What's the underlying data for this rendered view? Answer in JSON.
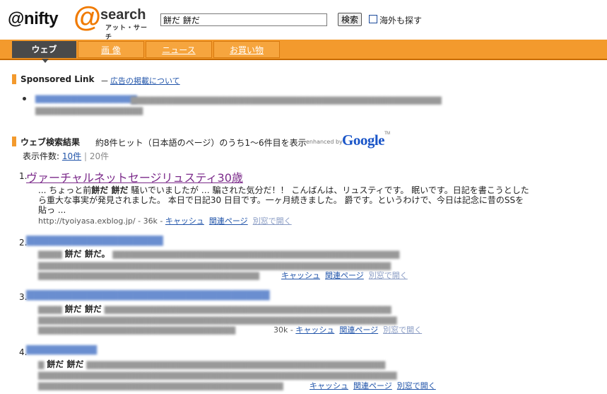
{
  "header": {
    "logo_nifty": "@nifty",
    "logo_at": "@",
    "logo_search": "search",
    "logo_sub": "アット・サーチ",
    "search_value": "餅だ 餅だ",
    "search_button": "検索",
    "overseas_label": "海外も探す"
  },
  "tabs": [
    {
      "label": "ウェブ",
      "active": true
    },
    {
      "label": "画 像"
    },
    {
      "label": "ニュース"
    },
    {
      "label": "お買い物"
    }
  ],
  "sponsored": {
    "title": "Sponsored Link",
    "dash": "－",
    "link": "広告の掲載について"
  },
  "results_header": {
    "title": "ウェブ検索結果",
    "summary": "約8件ヒット（日本語のページ）のうち1〜6件目を表示",
    "enhanced": "enhanced by",
    "google": "Google",
    "tm": "TM",
    "display_label": "表示件数:",
    "opt_10": "10件",
    "sep": "|",
    "opt_20": "20件"
  },
  "results": [
    {
      "num": "1.",
      "title": "ヴァーチャルネットセージリュスティ30歳",
      "snippet_pre": "... ちょっと前",
      "snippet_bold": "餅だ 餅だ",
      "snippet_post": " 騒いでいましたが … 騙された気分だ！！ こんばんは、リュスティです。 眠いです。日記を書こうとしたら重大な事実が発見されました。 本日で日記30 日目です。一ヶ月続きました。 爵です。というわけで、今日は記念に昔のSSを貼っ ...",
      "url": "http://tyoiyasa.exblog.jp/ - 36k -",
      "cache": "キャッシュ",
      "related": "関連ページ",
      "newwin": "別窓で開く"
    },
    {
      "num": "2.",
      "snippet_bold": "餅だ 餅だ。",
      "cache": "キャッシュ",
      "related": "関連ページ",
      "newwin": "別窓で開く"
    },
    {
      "num": "3.",
      "snippet_bold": "餅だ 餅だ",
      "size": "30k -",
      "cache": "キャッシュ",
      "related": "関連ページ",
      "newwin": "別窓で開く"
    },
    {
      "num": "4.",
      "snippet_bold": "餅だ 餅だ",
      "cache": "キャッシュ",
      "related": "関連ページ",
      "newwin": "別窓で開く"
    }
  ],
  "colors": {
    "accent": "#f39a2d",
    "tab_active": "#4a4a4a",
    "link": "#2255aa",
    "visited": "#7b2a8a"
  }
}
